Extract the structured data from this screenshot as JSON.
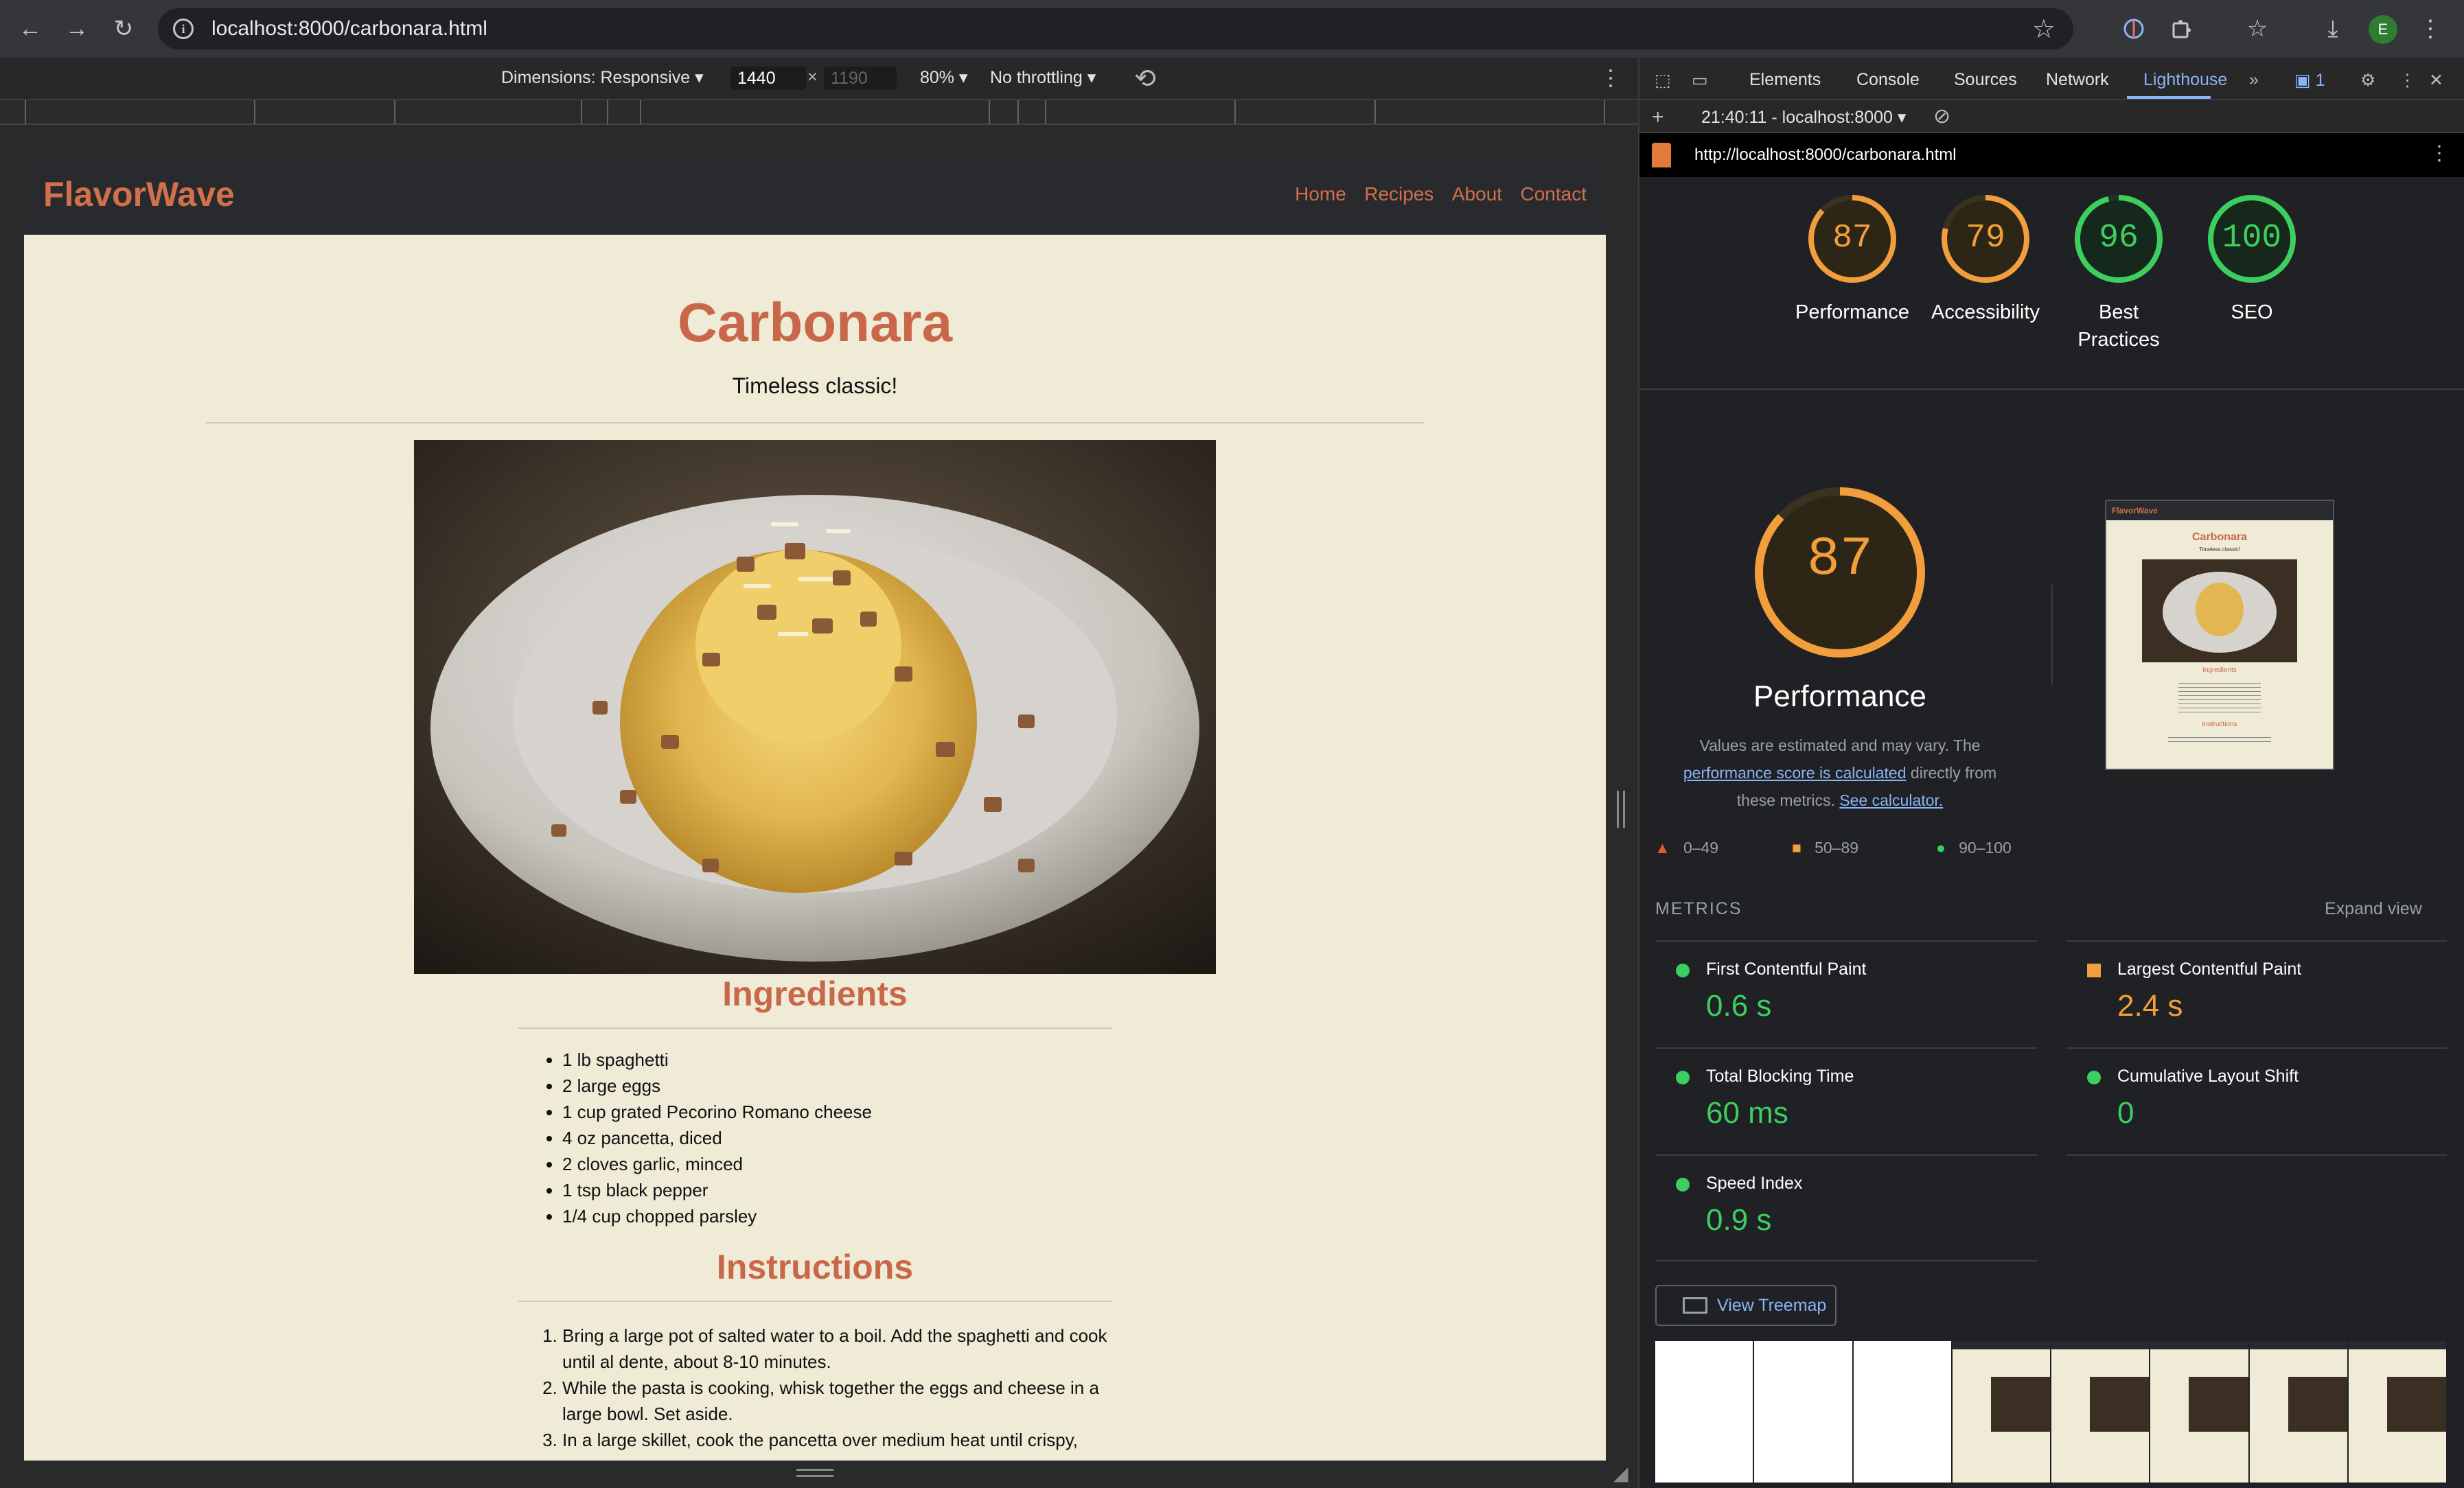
{
  "browser": {
    "url": "localhost:8000/carbonara.html"
  },
  "device_toolbar": {
    "dimensions": "Dimensions: Responsive ▾",
    "width": "1440",
    "x": "×",
    "height": "1190",
    "zoom": "80% ▾",
    "throttling": "No throttling ▾"
  },
  "site": {
    "logo": "FlavorWave",
    "nav": [
      "Home",
      "Recipes",
      "About",
      "Contact"
    ],
    "title": "Carbonara",
    "tagline": "Timeless classic!",
    "ingredients_heading": "Ingredients",
    "ingredients": [
      "1 lb spaghetti",
      "2 large eggs",
      "1 cup grated Pecorino Romano cheese",
      "4 oz pancetta, diced",
      "2 cloves garlic, minced",
      "1 tsp black pepper",
      "1/4 cup chopped parsley"
    ],
    "instructions_heading": "Instructions",
    "instructions": [
      "Bring a large pot of salted water to a boil. Add the spaghetti and cook until al dente, about 8-10 minutes.",
      "While the pasta is cooking, whisk together the eggs and cheese in a large bowl. Set aside.",
      "In a large skillet, cook the pancetta over medium heat until crispy,"
    ]
  },
  "devtools": {
    "tabs": [
      "Elements",
      "Console",
      "Sources",
      "Network",
      "Lighthouse"
    ],
    "more_tabs": "»",
    "issues_count": "1",
    "run": "21:40:11 - localhost:8000 ▾",
    "report_url": "http://localhost:8000/carbonara.html",
    "scores": [
      {
        "label": "Performance",
        "value": "87",
        "score": 87,
        "color": "#f29e3c"
      },
      {
        "label": "Accessibility",
        "value": "79",
        "score": 79,
        "color": "#f29e3c"
      },
      {
        "label": "Best Practices",
        "value": "96",
        "score": 96,
        "color": "#3ccf60"
      },
      {
        "label": "SEO",
        "value": "100",
        "score": 100,
        "color": "#3ccf60"
      }
    ],
    "performance": {
      "score": "87",
      "title": "Performance",
      "desc_1": "Values are estimated and may vary. The",
      "link_1": "performance score is calculated",
      "desc_2": " directly from these metrics. ",
      "link_2": "See calculator."
    },
    "legend": [
      "0–49",
      "50–89",
      "90–100"
    ],
    "metrics_heading": "METRICS",
    "expand_view": "Expand view",
    "metrics": [
      {
        "name": "First Contentful Paint",
        "value": "0.6 s",
        "status": "good"
      },
      {
        "name": "Largest Contentful Paint",
        "value": "2.4 s",
        "status": "average"
      },
      {
        "name": "Total Blocking Time",
        "value": "60 ms",
        "status": "good"
      },
      {
        "name": "Cumulative Layout Shift",
        "value": "0",
        "status": "good"
      },
      {
        "name": "Speed Index",
        "value": "0.9 s",
        "status": "good"
      }
    ],
    "view_treemap": "View Treemap",
    "thumbnail": {
      "logo": "FlavorWave",
      "title": "Carbonara",
      "tagline": "Timeless classic!",
      "ingredients": "Ingredients",
      "instructions": "Instructions"
    }
  },
  "colors": {
    "accent": "#c9674a",
    "page_bg": "#efebd6",
    "good": "#3ccf60",
    "average": "#f29e3c",
    "link": "#8ab4f8"
  }
}
